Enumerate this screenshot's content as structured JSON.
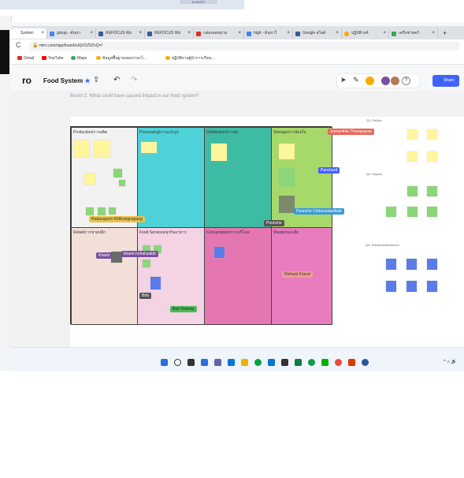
{
  "top_strip": {
    "badge": "ครอบครัว"
  },
  "tabs": [
    {
      "label": "System",
      "color": "#666666"
    },
    {
      "label": "group - ค้นหา",
      "color": "#4285f4"
    },
    {
      "label": "REFOCUS Wo",
      "color": "#3c5a99"
    },
    {
      "label": "REFOCUS Wo",
      "color": "#3c5a99"
    },
    {
      "label": "กล่องจดหมาย",
      "color": "#d93025"
    },
    {
      "label": "high - ค้นหาใ",
      "color": "#4285f4"
    },
    {
      "label": "Google สไลด์",
      "color": "#3c5a99"
    },
    {
      "label": "ปฏิบัติวงค์",
      "color": "#f9ab00"
    },
    {
      "label": "เครือข่ายครั",
      "color": "#34a853"
    }
  ],
  "address": {
    "url": "miro.com/app/board/uXjVOZ5ZvQ=/"
  },
  "bookmarks": [
    {
      "label": "Gmail",
      "color": "#d93025"
    },
    {
      "label": "YouTube",
      "color": "#ff0000"
    },
    {
      "label": "Maps",
      "color": "#34a853"
    },
    {
      "label": "ข้อมูลพื้นฐานของภาษาไ...",
      "color": "#f9ab00"
    },
    {
      "label": "ปฏิบัติงานผู้นำการเรียน...",
      "color": "#f9ab00"
    }
  ],
  "toolbar": {
    "logo": "ro",
    "board_name": "Food System",
    "star": "★",
    "share_label": "Share",
    "more_users": "?"
  },
  "board": {
    "subtitle": "Board 2: What could have caused impact in our food system?",
    "cells": {
      "production": "Production/การผลิต",
      "processing": "Processing/การแปรรูป",
      "distribution": "Distribution/การส่ง",
      "storage": "Storage/การจัดเก็บ",
      "retail": "Retail/การขายปลีก",
      "food_services": "Food Services/ธุรกิจอาหาร",
      "consumption": "Consumption/การบริโภค",
      "waste": "Waste/ของเสีย"
    },
    "side_labels": {
      "failure": "Q1: Failure",
      "impact": "Q2: Impact",
      "solutions": "Q3: Solutions/Measures"
    },
    "cursors": [
      {
        "name": "Samanthia Thanapapan",
        "color": "#e8655a"
      },
      {
        "name": "Panchard",
        "color": "#4262ff"
      },
      {
        "name": "Rattanaporn Kittikongnapang",
        "color": "#e9c24a"
      },
      {
        "name": "Poonche Chitanuntasilsak",
        "color": "#3a9ad9"
      },
      {
        "name": "Poonche",
        "color": "#555555"
      },
      {
        "name": "Kharin",
        "color": "#7a4fa0"
      },
      {
        "name": "kharin holrahsakdi",
        "color": "#7a4fa0"
      },
      {
        "name": "Richard Friend",
        "color": "#f09a9a"
      },
      {
        "name": "Bob",
        "color": "#555555"
      },
      {
        "name": "Bob Doherty",
        "color": "#4bbb5a"
      }
    ]
  }
}
